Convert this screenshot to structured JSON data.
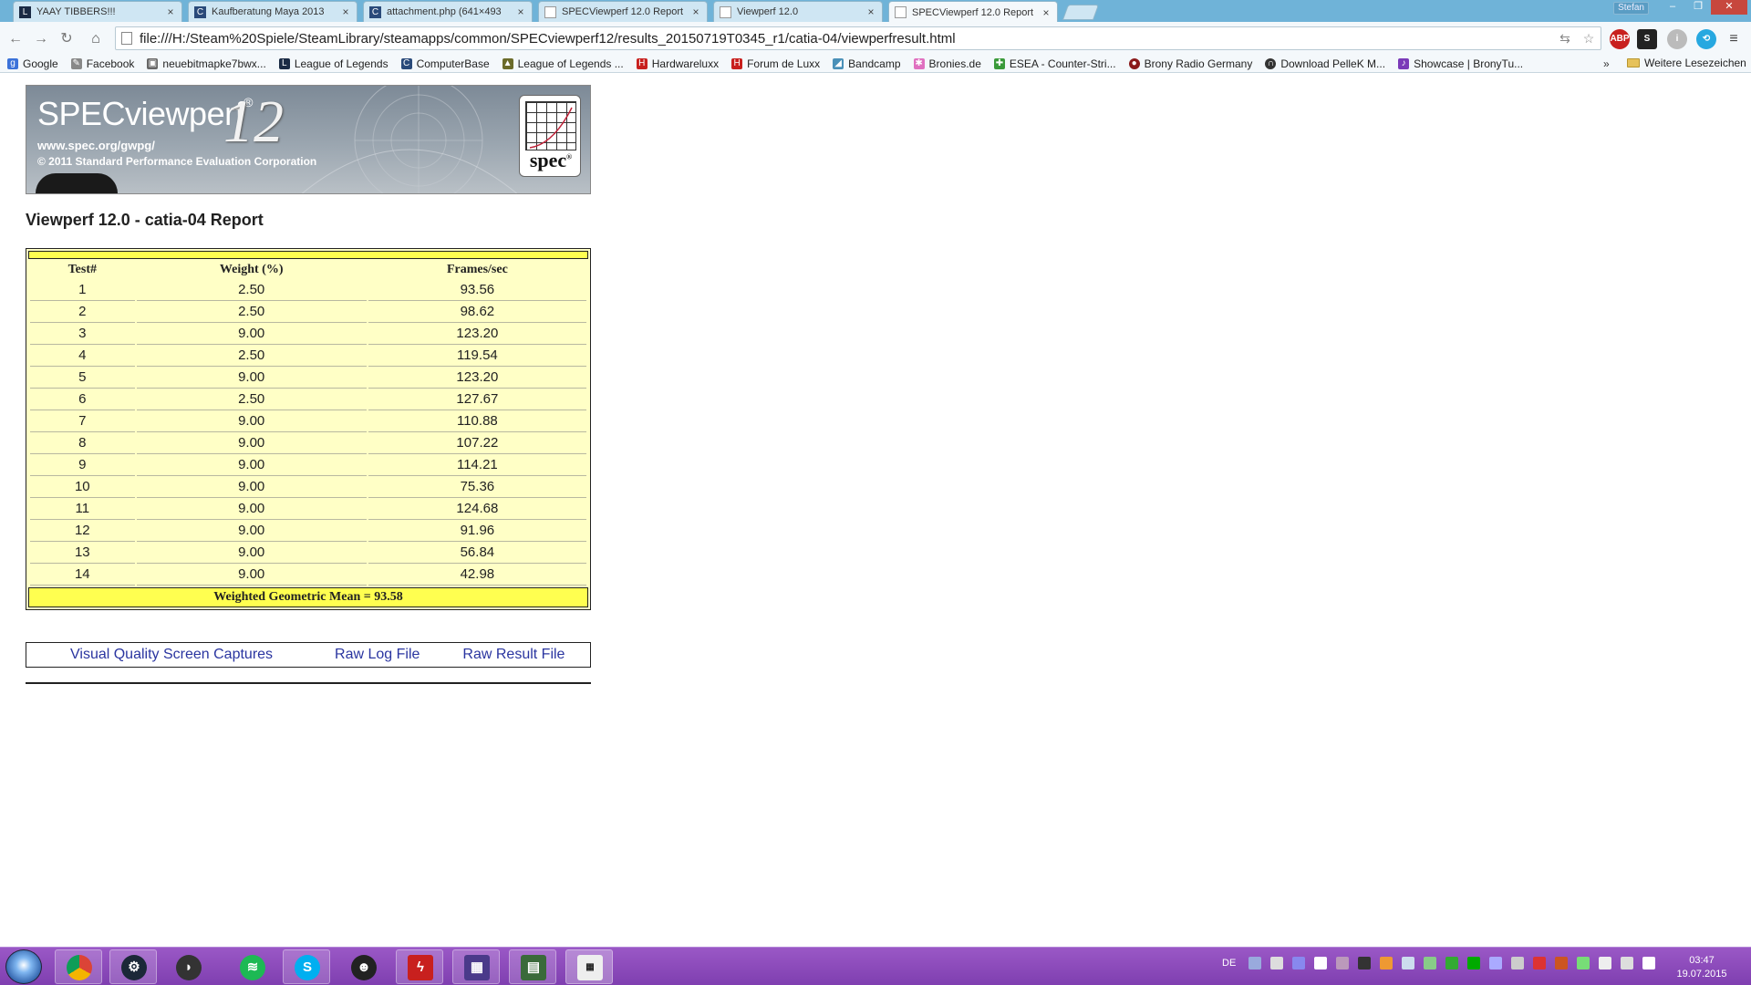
{
  "browser": {
    "tabs": [
      {
        "title": "YAAY TIBBERS!!!",
        "icon": "league-of-legends-icon"
      },
      {
        "title": "Kaufberatung Maya 2013",
        "icon": "forum-icon"
      },
      {
        "title": "attachment.php (641×493",
        "icon": "forum-icon"
      },
      {
        "title": "SPECViewperf 12.0 Report",
        "icon": "page-icon"
      },
      {
        "title": "Viewperf 12.0",
        "icon": "page-icon"
      },
      {
        "title": "SPECViewperf 12.0 Report",
        "icon": "page-icon"
      }
    ],
    "user_name": "Stefan",
    "url": "file:///H:/Steam%20Spiele/SteamLibrary/steamapps/common/SPECviewperf12/results_20150719T0345_r1/catia-04/viewperfresult.html",
    "bookmarks": [
      "Google",
      "Facebook",
      "neuebitmapke7bwx...",
      "League of Legends",
      "ComputerBase",
      "League of Legends ...",
      "Hardwareluxx",
      "Forum de Luxx",
      "Bandcamp",
      "Bronies.de",
      "ESEA - Counter-Stri...",
      "Brony Radio Germany",
      "Download PelleK M...",
      "Showcase | BronyTu..."
    ],
    "bookmarks_more": "»",
    "other_bookmarks": "Weitere Lesezeichen"
  },
  "banner": {
    "brand": "SPECviewperf",
    "reg": "®",
    "version": "12",
    "site": "www.spec.org/gwpg/",
    "copyright": "© 2011 Standard Performance Evaluation Corporation",
    "logo_word": "spec",
    "logo_reg": "®"
  },
  "report": {
    "title": "Viewperf 12.0 - catia-04 Report",
    "headers": [
      "Test#",
      "Weight (%)",
      "Frames/sec"
    ],
    "rows": [
      [
        "1",
        "2.50",
        "93.56"
      ],
      [
        "2",
        "2.50",
        "98.62"
      ],
      [
        "3",
        "9.00",
        "123.20"
      ],
      [
        "4",
        "2.50",
        "119.54"
      ],
      [
        "5",
        "9.00",
        "123.20"
      ],
      [
        "6",
        "2.50",
        "127.67"
      ],
      [
        "7",
        "9.00",
        "110.88"
      ],
      [
        "8",
        "9.00",
        "107.22"
      ],
      [
        "9",
        "9.00",
        "114.21"
      ],
      [
        "10",
        "9.00",
        "75.36"
      ],
      [
        "11",
        "9.00",
        "124.68"
      ],
      [
        "12",
        "9.00",
        "91.96"
      ],
      [
        "13",
        "9.00",
        "56.84"
      ],
      [
        "14",
        "9.00",
        "42.98"
      ]
    ],
    "mean": "Weighted Geometric Mean = 93.58"
  },
  "links": {
    "screen_captures": "Visual Quality Screen Captures",
    "raw_log": "Raw Log File",
    "raw_result": "Raw Result File"
  },
  "taskbar": {
    "apps": [
      "chrome",
      "steam",
      "amd-gaming-evolved",
      "spotify",
      "skype",
      "mask-app",
      "flash-app",
      "cpu-z",
      "task-manager",
      "specviewperf"
    ],
    "language": "DE",
    "time": "03:47",
    "date": "19.07.2015"
  },
  "colors": {
    "table_background": "#ffffc6",
    "table_bars": "#ffff50",
    "link_color": "#2a35a0",
    "taskbar": "#8a48bb",
    "tabstrip": "#6fb3d8"
  }
}
